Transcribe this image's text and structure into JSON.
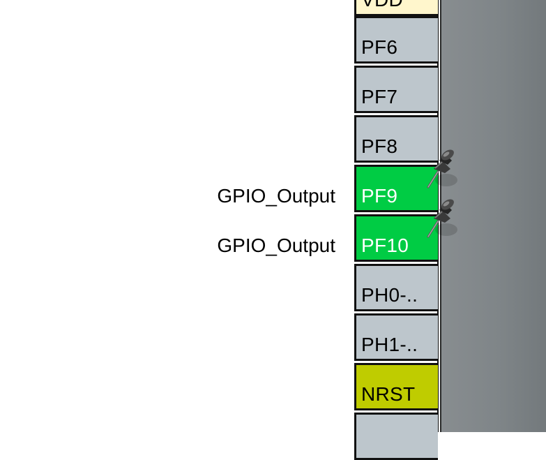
{
  "colors": {
    "pin_default": "#bdc6cc",
    "pin_assigned": "#00cc44",
    "pin_reset": "#bfcc00",
    "pin_power": "#fff6cc",
    "chip_body": "#808689"
  },
  "pins": [
    {
      "name": "VDD",
      "state": "power"
    },
    {
      "name": "PF6",
      "state": "default"
    },
    {
      "name": "PF7",
      "state": "default"
    },
    {
      "name": "PF8",
      "state": "default"
    },
    {
      "name": "PF9",
      "state": "assigned",
      "signal": "GPIO_Output",
      "pinned": true
    },
    {
      "name": "PF10",
      "state": "assigned",
      "signal": "GPIO_Output",
      "pinned": true
    },
    {
      "name": "PH0-..",
      "state": "default"
    },
    {
      "name": "PH1-..",
      "state": "default"
    },
    {
      "name": "NRST",
      "state": "reset"
    },
    {
      "name": "",
      "state": "default"
    }
  ],
  "icons": {
    "pushpin": "pushpin-icon"
  }
}
